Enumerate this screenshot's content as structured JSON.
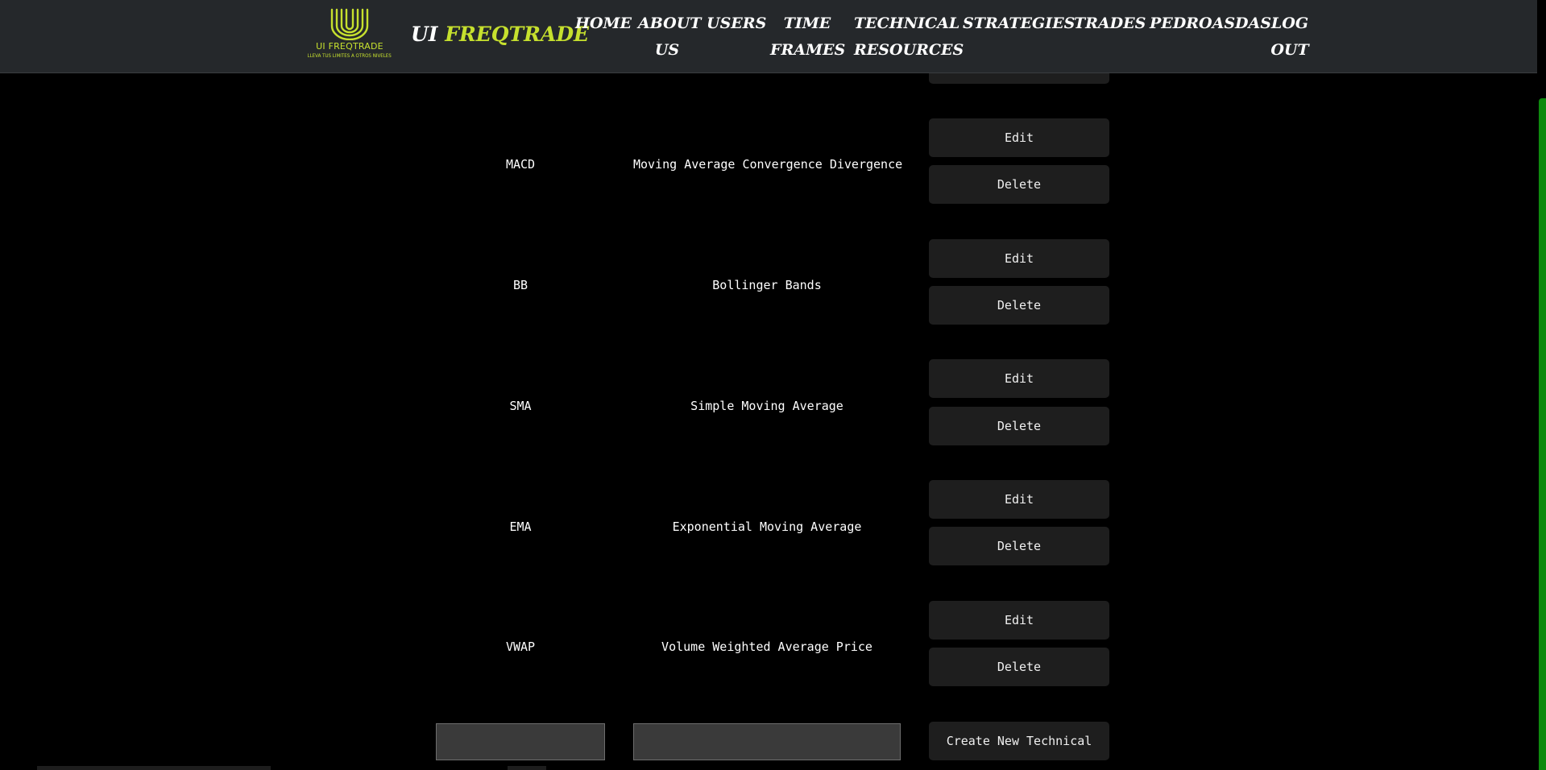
{
  "brand": {
    "logo_title": "UI FREQTRADE",
    "logo_tagline": "LLEVA TUS LIMITES A OTROS NIVELES",
    "name_part1": "UI",
    "name_part2": "FREQTRADE",
    "accent_color": "#c6e02e"
  },
  "nav": {
    "home": "HOME",
    "about_line1": "ABOUT",
    "about_line2": "US",
    "users": "USERS",
    "timeframes_line1": "TIME",
    "timeframes_line2": "FRAMES",
    "technical_line1": "TECHNICAL",
    "technical_line2": "RESOURCES",
    "strategies": "STRATEGIES",
    "trades": "TRADES",
    "user": "PEDROASDAS",
    "logout_line1": "LOG",
    "logout_line2": "OUT"
  },
  "technicals": [
    {
      "code": "MACD",
      "name": "Moving Average Convergence Divergence"
    },
    {
      "code": "BB",
      "name": "Bollinger Bands"
    },
    {
      "code": "SMA",
      "name": "Simple Moving Average"
    },
    {
      "code": "EMA",
      "name": "Exponential Moving Average"
    },
    {
      "code": "VWAP",
      "name": "Volume Weighted Average Price"
    }
  ],
  "actions": {
    "edit": "Edit",
    "delete": "Delete",
    "create": "Create New Technical"
  },
  "form": {
    "code_value": "",
    "name_value": ""
  },
  "colors": {
    "header_bg": "#25282b",
    "button_bg": "#1e1e1e",
    "scrollbar": "#0e8a0e"
  }
}
